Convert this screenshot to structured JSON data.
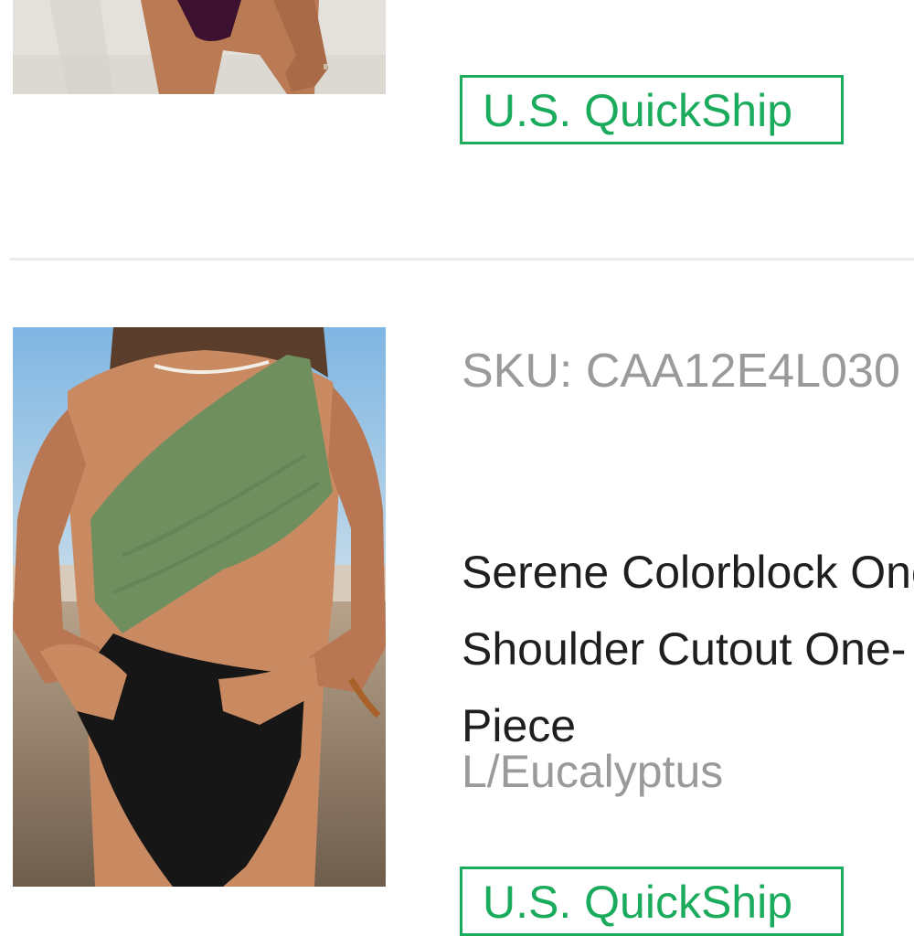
{
  "items": [
    {
      "badge": "U.S. QuickShip",
      "image_alt": "purple bikini bottom on beach"
    },
    {
      "sku": "SKU: CAA12E4L030",
      "title": "Serene Colorblock One-Shoulder Cutout One-Piece",
      "variant": "L/Eucalyptus",
      "badge": "U.S. QuickShip",
      "image_alt": "one-shoulder cutout swimsuit in eucalyptus green and black"
    }
  ],
  "colors": {
    "badge_green": "#1aab5c",
    "muted_text": "#9a9a9a",
    "title_text": "#1f1f1f"
  }
}
